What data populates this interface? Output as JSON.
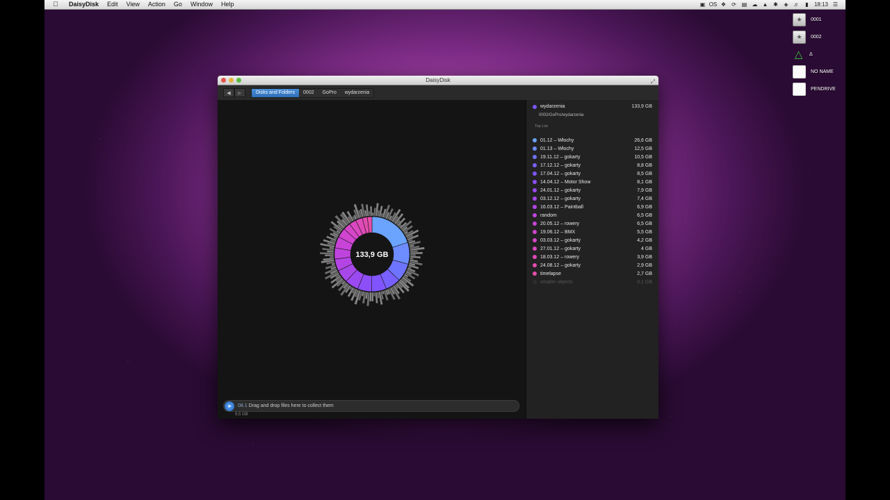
{
  "menubar": {
    "app_name": "DaisyDisk",
    "items": [
      "Edit",
      "View",
      "Action",
      "Go",
      "Window",
      "Help"
    ],
    "clock": "18:13",
    "tray_text": "OS"
  },
  "desktop": {
    "drives": [
      {
        "label": "0001",
        "icon": "drive-icon"
      },
      {
        "label": "0002",
        "icon": "drive-icon"
      },
      {
        "label": "Δ",
        "icon": "triangle-icon"
      },
      {
        "label": "NO NAME",
        "icon": "removable-drive-icon"
      },
      {
        "label": "PENDRIVE",
        "icon": "removable-drive-icon"
      }
    ]
  },
  "window": {
    "title": "DaisyDisk",
    "breadcrumbs": [
      "Disks and Folders",
      "0002",
      "GoPro",
      "wydarzenia"
    ],
    "center_label": "133,9 GB",
    "sidebar": {
      "folder_name": "wydarzenia",
      "folder_size": "133,9 GB",
      "folder_path": "0002/GoPro/wydarzenia",
      "toplist_label": "Top List",
      "items": [
        {
          "name": "01.12 – Włochy",
          "size": "26,6 GB",
          "color": "#6aa4ff"
        },
        {
          "name": "01.13 – Włochy",
          "size": "12,5 GB",
          "color": "#6d8cff"
        },
        {
          "name": "19.11.12 – gokarty",
          "size": "10,5 GB",
          "color": "#6f74ff"
        },
        {
          "name": "17.12.12 – gokarty",
          "size": "8,8 GB",
          "color": "#7760ff"
        },
        {
          "name": "17.04.12 – gokarty",
          "size": "8,5 GB",
          "color": "#8055ff"
        },
        {
          "name": "14.04.12 – Motor Show",
          "size": "8,1 GB",
          "color": "#8c4ff7"
        },
        {
          "name": "24.01.12 – gokarty",
          "size": "7,9 GB",
          "color": "#9a4af0"
        },
        {
          "name": "03.12.12 – gokarty",
          "size": "7,4 GB",
          "color": "#a847ea"
        },
        {
          "name": "16.03.12 – Paintball",
          "size": "6,9 GB",
          "color": "#b445e4"
        },
        {
          "name": "random",
          "size": "6,5 GB",
          "color": "#bf44de"
        },
        {
          "name": "20.05.12 – rowery",
          "size": "6,5 GB",
          "color": "#c844d8"
        },
        {
          "name": "19.06.12 – BMX",
          "size": "5,5 GB",
          "color": "#d044d0"
        },
        {
          "name": "03.03.12 – gokarty",
          "size": "4,2 GB",
          "color": "#d646c8"
        },
        {
          "name": "27.01.12 – gokarty",
          "size": "4   GB",
          "color": "#db48c0"
        },
        {
          "name": "18.03.12 – rowery",
          "size": "3,9 GB",
          "color": "#df4ab8"
        },
        {
          "name": "24.08.12 – gokarty",
          "size": "2,9 GB",
          "color": "#e24cb0"
        },
        {
          "name": "timelapse",
          "size": "2,7 GB",
          "color": "#e54ea8"
        },
        {
          "name": "smaller objects",
          "size": "0,1 GB",
          "color": "#555555",
          "faded": true
        }
      ]
    },
    "collector": {
      "text": "Drag and drop files here to collect them",
      "overlay_text": "08.1",
      "size": "9,5 GB"
    }
  },
  "colors": {
    "accent_blue": "#2e6fb8",
    "highlight_folder": "#7a55ff"
  }
}
